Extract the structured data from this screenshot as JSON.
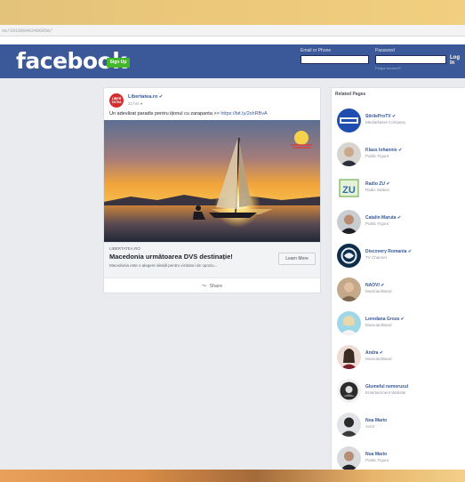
{
  "browser": {
    "url": "oe/101808403406950/"
  },
  "header": {
    "logo": "facebook",
    "signup_label": "Sign Up",
    "email_label": "Email or Phone",
    "password_label": "Password",
    "forgot_label": "Forgot account?",
    "login_label": "Log In"
  },
  "post": {
    "page_name": "Libertatea.ro",
    "time": "22 hrs",
    "text": "Un adevărat paradis pentru iționul cu zarapanta >>",
    "link": "https://bit.ly/2xhRBvA",
    "avatar_text": "LIBER TATEA",
    "preview": {
      "domain": "LIBERTATEA.RO",
      "title": "Macedonia următoarea DVS destinație!",
      "description": "Macedonia este o alegere ideală pentru vizitatori de opoziu...",
      "cta": "Learn More"
    },
    "share_label": "Share"
  },
  "related": {
    "title": "Related Pages",
    "items": [
      {
        "name": "StirileProTV",
        "category": "Media/News Company",
        "verified": "✔"
      },
      {
        "name": "Klaus Iohannis",
        "category": "Public Figure",
        "verified": "✔"
      },
      {
        "name": "Radio ZU",
        "category": "Radio Station",
        "verified": "✔"
      },
      {
        "name": "Catalin Maruta",
        "category": "Public Figure",
        "verified": "✔"
      },
      {
        "name": "Discovery Romania",
        "category": "TV Channel",
        "verified": "✔"
      },
      {
        "name": "NAOVI",
        "category": "Musician/Band",
        "verified": "✔"
      },
      {
        "name": "Loredana Groza",
        "category": "Musician/Band",
        "verified": "✔"
      },
      {
        "name": "Andra",
        "category": "Musician/Band",
        "verified": "✔"
      },
      {
        "name": "Glumeful nemeruzul",
        "category": "Entertainment Website",
        "verified": ""
      },
      {
        "name": "Noa Marin",
        "category": "Actor",
        "verified": ""
      },
      {
        "name": "Noa Marin",
        "category": "Public Figure",
        "verified": ""
      }
    ]
  },
  "colors": {
    "fb_blue": "#3b5998",
    "signup_green": "#42b72a",
    "link_blue": "#365899",
    "page_bg": "#e9ebee"
  }
}
